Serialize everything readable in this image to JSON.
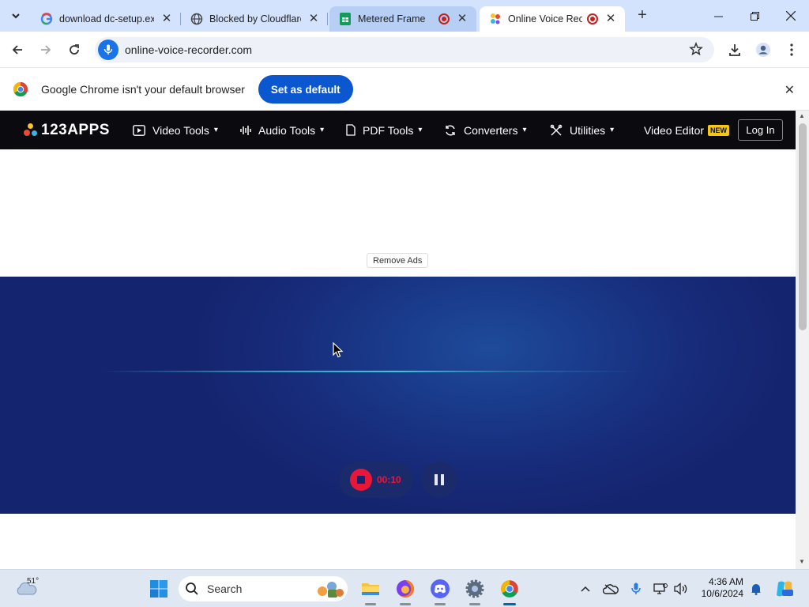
{
  "browser": {
    "tabs": [
      {
        "title": "download dc-setup.exe",
        "favicon": "google-icon",
        "recording": false
      },
      {
        "title": "Blocked by Cloudflare",
        "favicon": "globe-icon",
        "recording": false
      },
      {
        "title": "Metered Frame",
        "favicon": "sheets-icon",
        "recording": true
      },
      {
        "title": "Online Voice Recorder",
        "favicon": "123apps-icon",
        "recording": true,
        "active": true
      }
    ],
    "address": "online-voice-recorder.com"
  },
  "infobar": {
    "message": "Google Chrome isn't your default browser",
    "button": "Set as default"
  },
  "site": {
    "brand": "123APPS",
    "nav": [
      {
        "label": "Video Tools",
        "icon": "play-icon"
      },
      {
        "label": "Audio Tools",
        "icon": "waveform-icon"
      },
      {
        "label": "PDF Tools",
        "icon": "document-icon"
      },
      {
        "label": "Converters",
        "icon": "convert-icon"
      },
      {
        "label": "Utilities",
        "icon": "tools-icon"
      }
    ],
    "video_editor": "Video Editor",
    "new_badge": "NEW",
    "login": "Log In",
    "remove_ads": "Remove Ads"
  },
  "recorder": {
    "timer": "00:10"
  },
  "taskbar": {
    "temperature": "51°",
    "search_label": "Search",
    "time": "4:36 AM",
    "date": "10/6/2024"
  },
  "colors": {
    "accent": "#0b57d0",
    "record_red": "#e8173a",
    "recorder_bg": "#172b7a",
    "site_nav": "#0a0a0f"
  }
}
